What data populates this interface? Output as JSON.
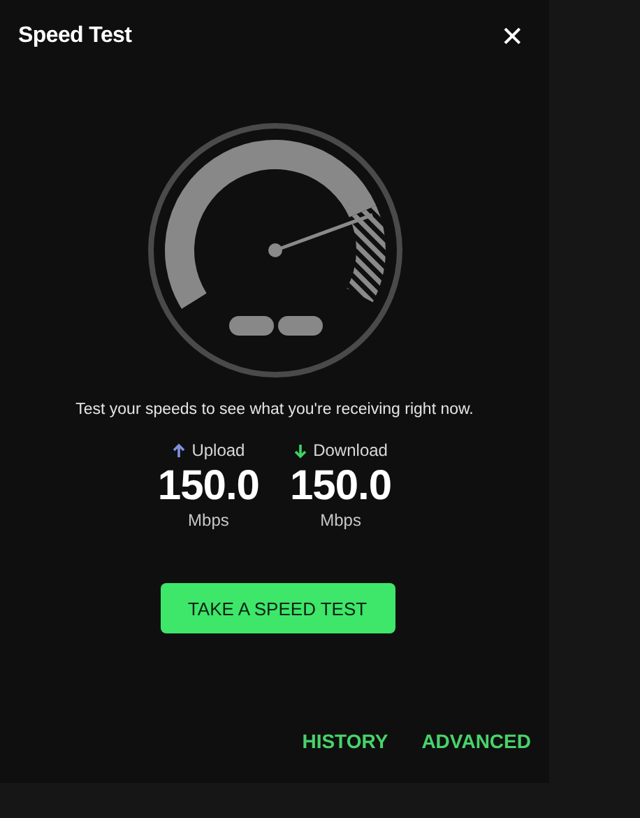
{
  "dialog": {
    "title": "Speed Test",
    "close": "✕"
  },
  "description": "Test your speeds to see what you're receiving right now.",
  "speeds": [
    {
      "kind": "upload",
      "label": "Upload",
      "value": "150.0",
      "unit": "Mbps"
    },
    {
      "kind": "download",
      "label": "Download",
      "value": "150.0",
      "unit": "Mbps"
    }
  ],
  "primary_button": "TAKE A SPEED TEST",
  "links": [
    "HISTORY",
    "ADVANCED"
  ]
}
